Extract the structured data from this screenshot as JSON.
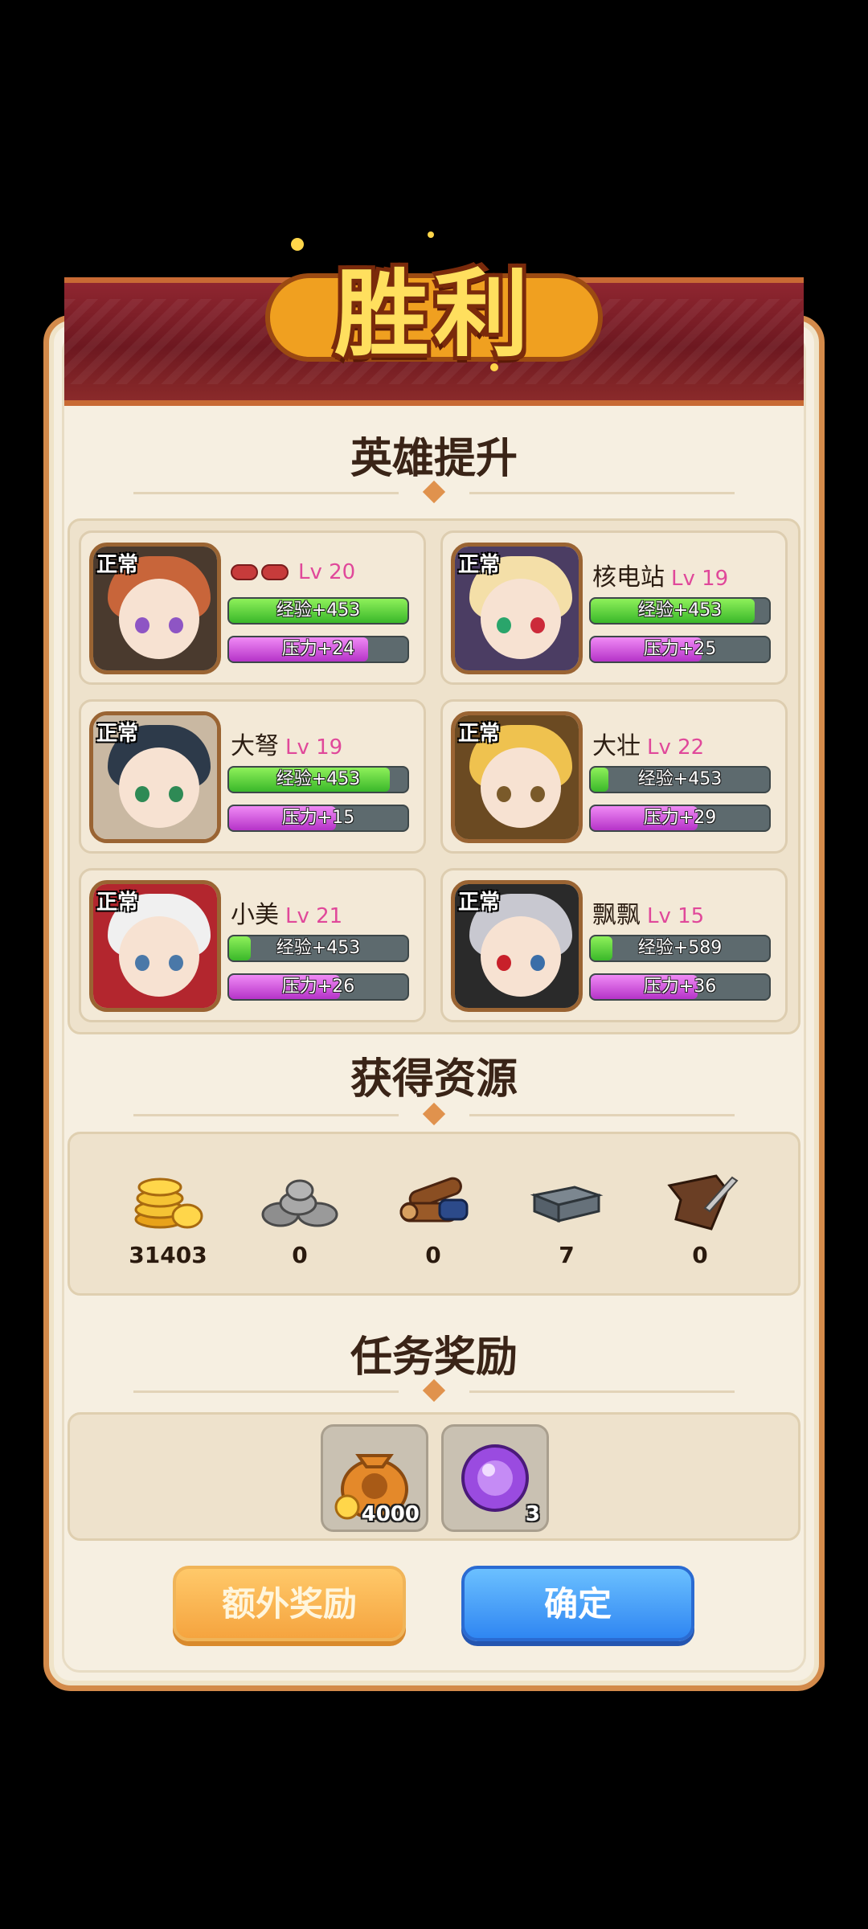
{
  "header": {
    "title": "胜利"
  },
  "sections": {
    "heroes_title": "英雄提升",
    "resources_title": "获得资源",
    "rewards_title": "任务奖励"
  },
  "heroes": [
    {
      "status": "正常",
      "name": "",
      "level": "Lv 20",
      "exp": "经验+453",
      "exp_fill": 1.0,
      "pressure": "压力+24",
      "pressure_fill": 0.78
    },
    {
      "status": "正常",
      "name": "核电站",
      "level": "Lv 19",
      "exp": "经验+453",
      "exp_fill": 0.92,
      "pressure": "压力+25",
      "pressure_fill": 0.62
    },
    {
      "status": "正常",
      "name": "大弩",
      "level": "Lv 19",
      "exp": "经验+453",
      "exp_fill": 0.9,
      "pressure": "压力+15",
      "pressure_fill": 0.6
    },
    {
      "status": "正常",
      "name": "大壮",
      "level": "Lv 22",
      "exp": "经验+453",
      "exp_fill": 0.1,
      "pressure": "压力+29",
      "pressure_fill": 0.6
    },
    {
      "status": "正常",
      "name": "小美",
      "level": "Lv 21",
      "exp": "经验+453",
      "exp_fill": 0.12,
      "pressure": "压力+26",
      "pressure_fill": 0.62
    },
    {
      "status": "正常",
      "name": "飘飘",
      "level": "Lv 15",
      "exp": "经验+589",
      "exp_fill": 0.12,
      "pressure": "压力+36",
      "pressure_fill": 0.6
    }
  ],
  "resources": [
    {
      "icon": "gold-coins-icon",
      "value": "31403"
    },
    {
      "icon": "stone-icon",
      "value": "0"
    },
    {
      "icon": "wood-logs-icon",
      "value": "0"
    },
    {
      "icon": "iron-ingot-icon",
      "value": "7"
    },
    {
      "icon": "leather-icon",
      "value": "0"
    }
  ],
  "rewards": [
    {
      "icon": "money-bag-icon",
      "qty": "4000"
    },
    {
      "icon": "purple-orb-icon",
      "qty": "3"
    }
  ],
  "buttons": {
    "extra": "额外奖励",
    "confirm": "确定"
  },
  "colors": {
    "accent_orange": "#f5a43f",
    "confirm_blue": "#2f86f2",
    "exp_green": "#3ab82a",
    "pressure_purple": "#b533c8",
    "level_pink": "#e0489a"
  }
}
